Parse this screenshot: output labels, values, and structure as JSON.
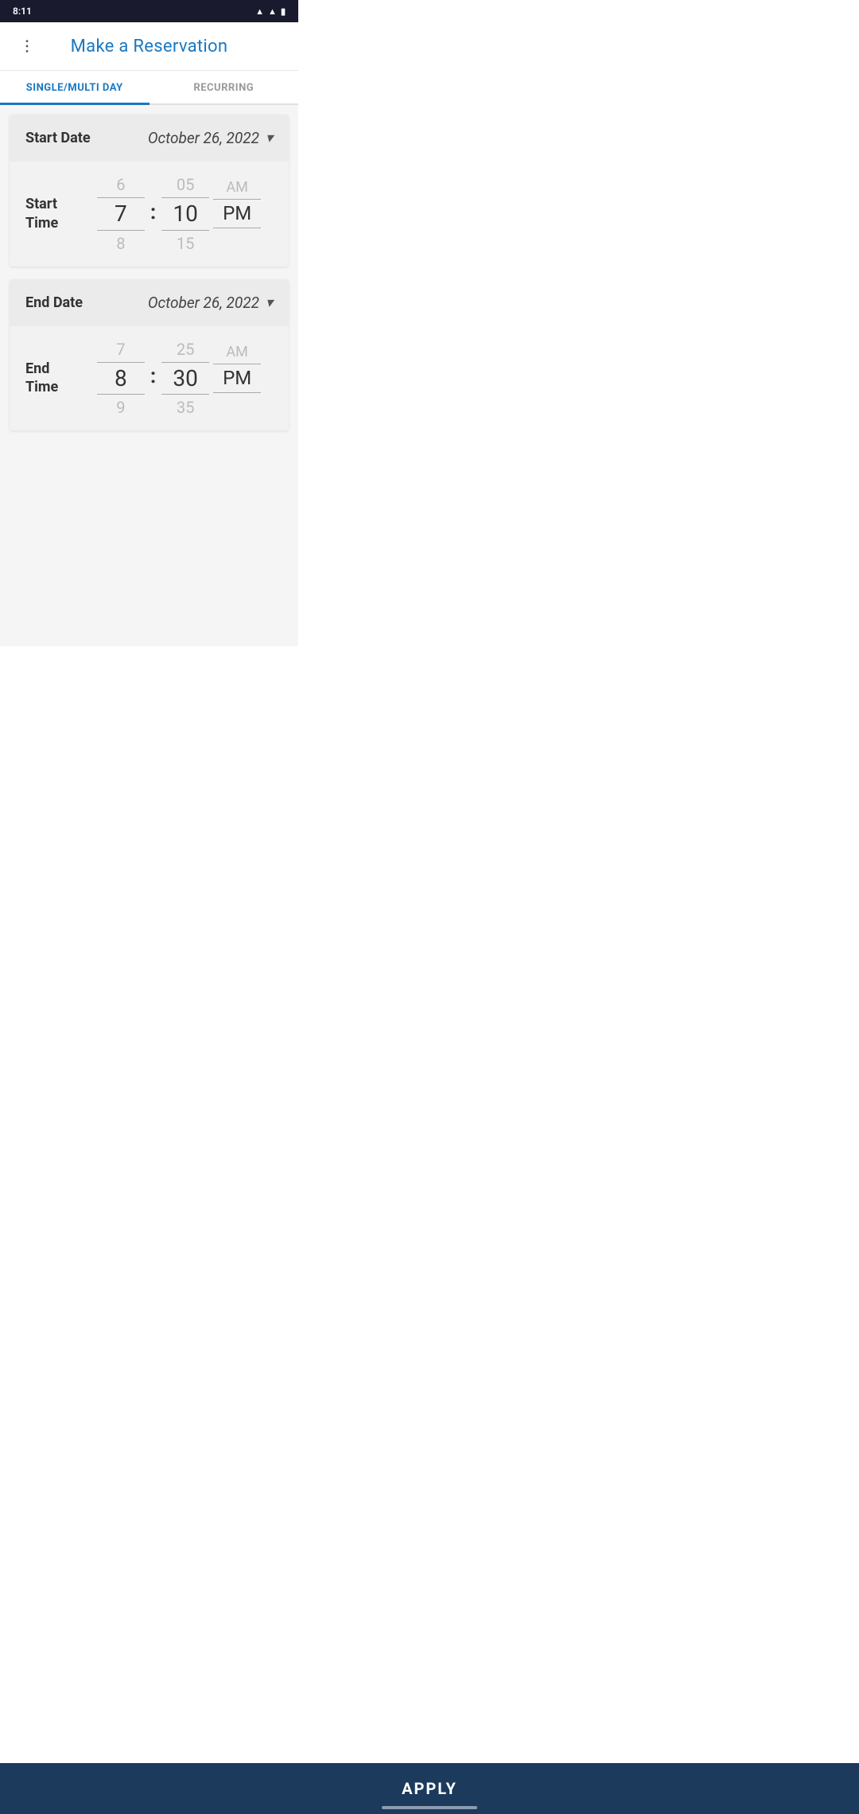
{
  "statusBar": {
    "time": "8:11",
    "icons": [
      "signal",
      "wifi",
      "battery"
    ]
  },
  "header": {
    "title": "Make a Reservation",
    "menuIcon": "more-vert"
  },
  "tabs": [
    {
      "id": "single",
      "label": "SINGLE/MULTI DAY",
      "active": true
    },
    {
      "id": "recurring",
      "label": "RECURRING",
      "active": false
    }
  ],
  "startDate": {
    "label": "Start Date",
    "value": "October 26, 2022"
  },
  "startTime": {
    "label": "Start\nTime",
    "hourAbove": "6",
    "hour": "7",
    "hourBelow": "8",
    "minuteAbove": "05",
    "minute": "10",
    "minuteBelow": "15",
    "ampmAbove": "AM",
    "ampm": "PM",
    "ampmBelow": ""
  },
  "endDate": {
    "label": "End Date",
    "value": "October 26, 2022"
  },
  "endTime": {
    "label": "End\nTime",
    "hourAbove": "7",
    "hour": "8",
    "hourBelow": "9",
    "minuteAbove": "25",
    "minute": "30",
    "minuteBelow": "35",
    "ampmAbove": "AM",
    "ampm": "PM",
    "ampmBelow": ""
  },
  "applyButton": {
    "label": "APPLY"
  }
}
